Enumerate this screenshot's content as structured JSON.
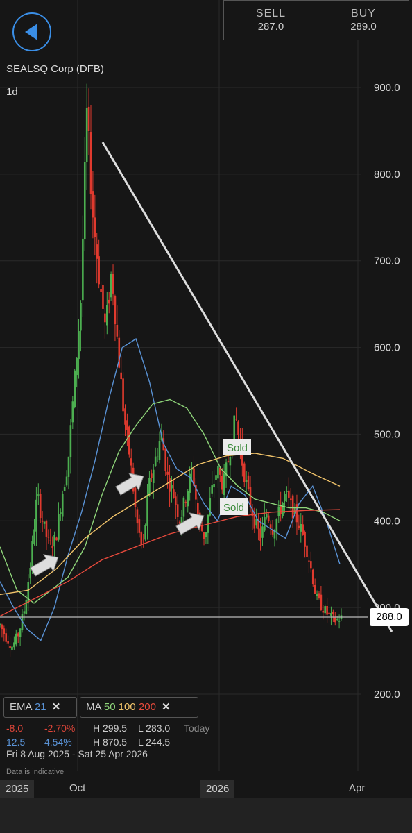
{
  "header": {
    "sell_label": "SELL",
    "sell_price": "287.0",
    "buy_label": "BUY",
    "buy_price": "289.0"
  },
  "instrument": "SEALSQ Corp (DFB)",
  "interval": "1d",
  "current_price_tag": "288.0",
  "annotations": [
    {
      "text": "Sold"
    },
    {
      "text": "Sold"
    }
  ],
  "legend": {
    "ema": {
      "name": "EMA",
      "period": "21"
    },
    "ma": {
      "name": "MA",
      "p1": "50",
      "p2": "100",
      "p3": "200"
    }
  },
  "stats": {
    "change_abs": "-8.0",
    "change_pct": "-2.70%",
    "high_today": "H 299.5",
    "low_today": "L 283.0",
    "today_label": "Today",
    "v2": "12.5",
    "v2_pct": "4.54%",
    "high_range": "H 870.5",
    "low_range": "L 244.5",
    "range": "Fri 8 Aug 2025 - Sat 25 Apr 2026",
    "indicative": "Data is indicative"
  },
  "colors": {
    "up": "#4caf50",
    "down": "#e03a2e",
    "ema21": "#5a93d6",
    "ma50": "#8fd67a",
    "ma100": "#f2c46a",
    "ma200": "#e84a3c",
    "trendline": "#dddddd"
  },
  "chart_data": {
    "type": "line",
    "title": "SEALSQ Corp (DFB)",
    "ylim": [
      200,
      900
    ],
    "y_ticks": [
      "900.0",
      "800.0",
      "700.0",
      "600.0",
      "500.0",
      "400.0",
      "300.0",
      "200.0"
    ],
    "x_ticks": [
      "2025",
      "Oct",
      "2026",
      "Apr"
    ],
    "grid": true,
    "series": [
      {
        "name": "EMA 21",
        "values": [
          330,
          300,
          275,
          262,
          300,
          360,
          410,
          470,
          540,
          600,
          610,
          560,
          490,
          460,
          450,
          420,
          400,
          440,
          430,
          400,
          390,
          380,
          420,
          440,
          400,
          350
        ]
      },
      {
        "name": "MA 50",
        "values": [
          370,
          320,
          305,
          320,
          335,
          370,
          430,
          480,
          510,
          535,
          540,
          530,
          500,
          460,
          440,
          425,
          420,
          415,
          415,
          410,
          400
        ]
      },
      {
        "name": "MA 100",
        "values": [
          315,
          320,
          345,
          380,
          405,
          425,
          445,
          465,
          475,
          478,
          472,
          455,
          440
        ]
      },
      {
        "name": "MA 200",
        "values": [
          290,
          310,
          330,
          355,
          370,
          385,
          395,
          405,
          410,
          412,
          413
        ]
      }
    ],
    "price_path": [
      280,
      265,
      255,
      270,
      300,
      355,
      430,
      395,
      370,
      380,
      430,
      470,
      560,
      650,
      870,
      750,
      680,
      620,
      690,
      600,
      520,
      470,
      400,
      365,
      440,
      470,
      500,
      450,
      430,
      400,
      430,
      460,
      400,
      380,
      430,
      460,
      440,
      480,
      520,
      470,
      430,
      400,
      380,
      410,
      390,
      410,
      430,
      415,
      400,
      380,
      350,
      310,
      300,
      290,
      285,
      288
    ]
  }
}
